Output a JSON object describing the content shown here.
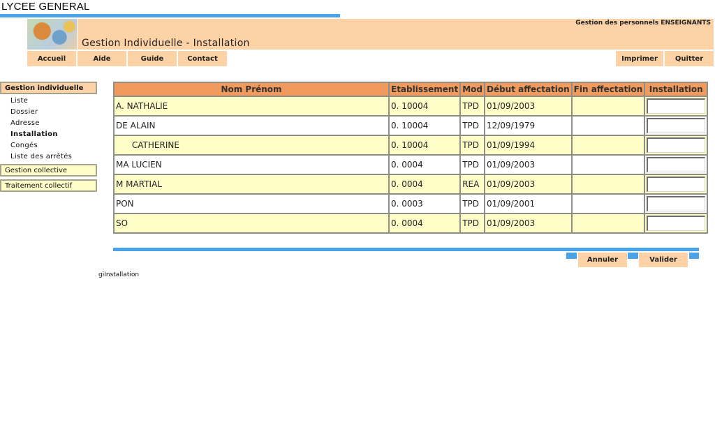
{
  "app": {
    "school": "LYCEE GENERAL",
    "header_right": "Gestion des personnels ENSEIGNANTS",
    "page_title": "Gestion Individuelle - Installation"
  },
  "nav": {
    "accueil": "Accueil",
    "aide": "Aide",
    "guide": "Guide",
    "contact": "Contact",
    "imprimer": "Imprimer",
    "quitter": "Quitter"
  },
  "sidebar": {
    "section_individuelle": "Gestion individuelle",
    "items": [
      "Liste",
      "Dossier",
      "Adresse",
      "Installation",
      "Congés",
      "Liste des arrêtés"
    ],
    "active_item": "Installation",
    "section_collective": "Gestion collective",
    "section_traitement": "Traitement collectif"
  },
  "table": {
    "headers": {
      "nom": "Nom Prénom",
      "etab": "Etablissement",
      "mod": "Mod",
      "debut": "Début affectation",
      "fin": "Fin affectation",
      "installation": "Installation"
    },
    "rows": [
      {
        "nom": "A.    NATHALIE",
        "etab": "0.  10004",
        "mod": "TPD",
        "debut": "01/09/2003",
        "fin": "",
        "installation": ""
      },
      {
        "nom": "DE    ALAIN",
        "etab": "0.  10004",
        "mod": "TPD",
        "debut": "12/09/1979",
        "fin": "",
        "installation": ""
      },
      {
        "nom": "      CATHERINE",
        "etab": "0.  10004",
        "mod": "TPD",
        "debut": "01/09/1994",
        "fin": "",
        "installation": ""
      },
      {
        "nom": "MA    LUCIEN",
        "etab": "0.  0004",
        "mod": "TPD",
        "debut": "01/09/2003",
        "fin": "",
        "installation": ""
      },
      {
        "nom": "M       MARTIAL",
        "etab": "0.  0004",
        "mod": "REA",
        "debut": "01/09/2003",
        "fin": "",
        "installation": ""
      },
      {
        "nom": "PON",
        "etab": "0.  0003",
        "mod": "TPD",
        "debut": "01/09/2001",
        "fin": "",
        "installation": ""
      },
      {
        "nom": "SO",
        "etab": "0.  0004",
        "mod": "TPD",
        "debut": "01/09/2003",
        "fin": "",
        "installation": ""
      }
    ]
  },
  "actions": {
    "annuler": "Annuler",
    "valider": "Valider"
  },
  "footer": {
    "code": "giInstallation"
  },
  "colors": {
    "accent_blue": "#4aa3e8",
    "header_peach": "#fcd2a6",
    "table_header": "#f09a5d",
    "row_yellow": "#fffdc8"
  }
}
